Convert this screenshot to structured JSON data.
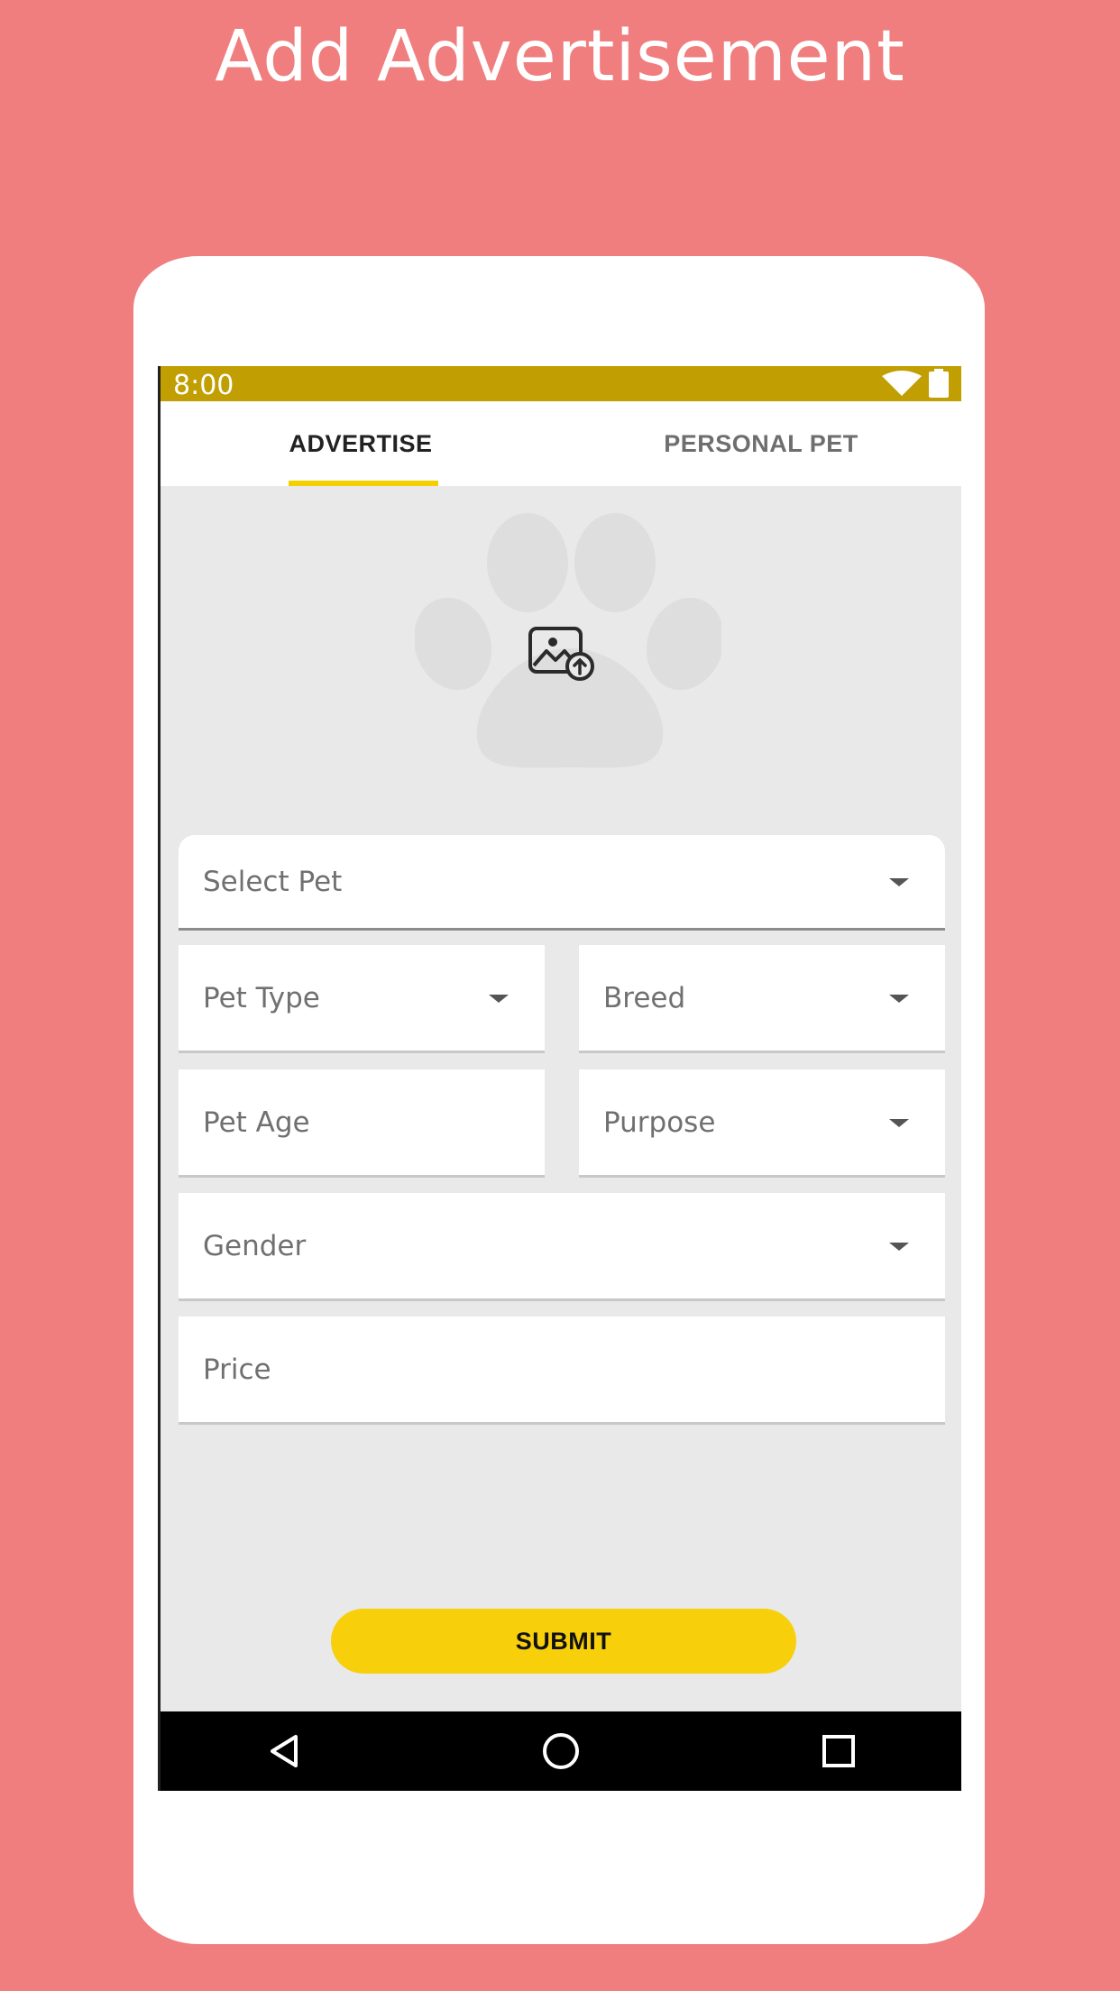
{
  "promo": {
    "title": "Add Advertisement"
  },
  "status_bar": {
    "time": "8:00",
    "icons": [
      "wifi-icon",
      "battery-icon"
    ]
  },
  "tabs": [
    {
      "label": "ADVERTISE",
      "active": true
    },
    {
      "label": "PERSONAL PET",
      "active": false
    }
  ],
  "upload": {
    "icons": [
      "paw-icon",
      "image-upload-icon"
    ]
  },
  "form": {
    "select_pet": "Select Pet",
    "pet_type": "Pet Type",
    "breed": "Breed",
    "pet_age": "Pet Age",
    "purpose": "Purpose",
    "gender": "Gender",
    "price": "Price",
    "submit": "SUBMIT"
  },
  "nav_bar": {
    "icons": [
      "back-icon",
      "home-icon",
      "recents-icon"
    ]
  },
  "colors": {
    "background": "#f07e7e",
    "status_bar": "#c19f02",
    "accent": "#f7cf0b",
    "tab_indicator": "#f5d000"
  }
}
